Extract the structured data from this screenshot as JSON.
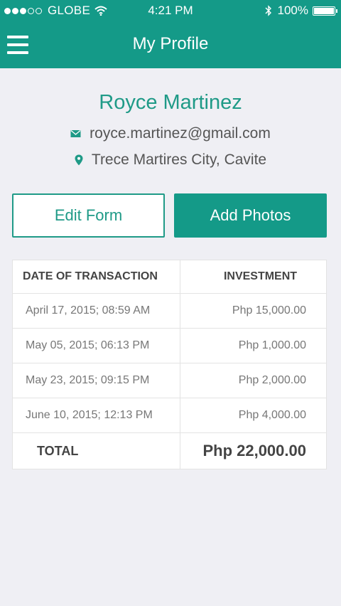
{
  "status_bar": {
    "carrier": "GLOBE",
    "time": "4:21 PM",
    "battery_percent": "100%",
    "battery_level": 1.0,
    "signal_dots": [
      true,
      true,
      true,
      false,
      false
    ]
  },
  "navbar": {
    "title": "My Profile",
    "menu_icon": "hamburger-menu-icon"
  },
  "profile": {
    "name": "Royce Martinez",
    "email": "royce.martinez@gmail.com",
    "location": "Trece Martires City, Cavite",
    "email_icon": "envelope-icon",
    "location_icon": "map-pin-icon"
  },
  "actions": {
    "edit_label": "Edit Form",
    "add_photos_label": "Add Photos"
  },
  "transactions": {
    "headers": [
      "DATE OF TRANSACTION",
      "INVESTMENT"
    ],
    "rows": [
      {
        "date": "April 17, 2015; 08:59 AM",
        "amount": "Php 15,000.00"
      },
      {
        "date": "May 05, 2015; 06:13 PM",
        "amount": "Php 1,000.00"
      },
      {
        "date": "May 23, 2015; 09:15 PM",
        "amount": "Php 2,000.00"
      },
      {
        "date": "June 10, 2015; 12:13 PM",
        "amount": "Php 4,000.00"
      }
    ],
    "total_label": "TOTAL",
    "total_amount": "Php 22,000.00"
  },
  "colors": {
    "accent": "#149a88",
    "accent_text": "#1f9a87",
    "background": "#efeff4"
  }
}
